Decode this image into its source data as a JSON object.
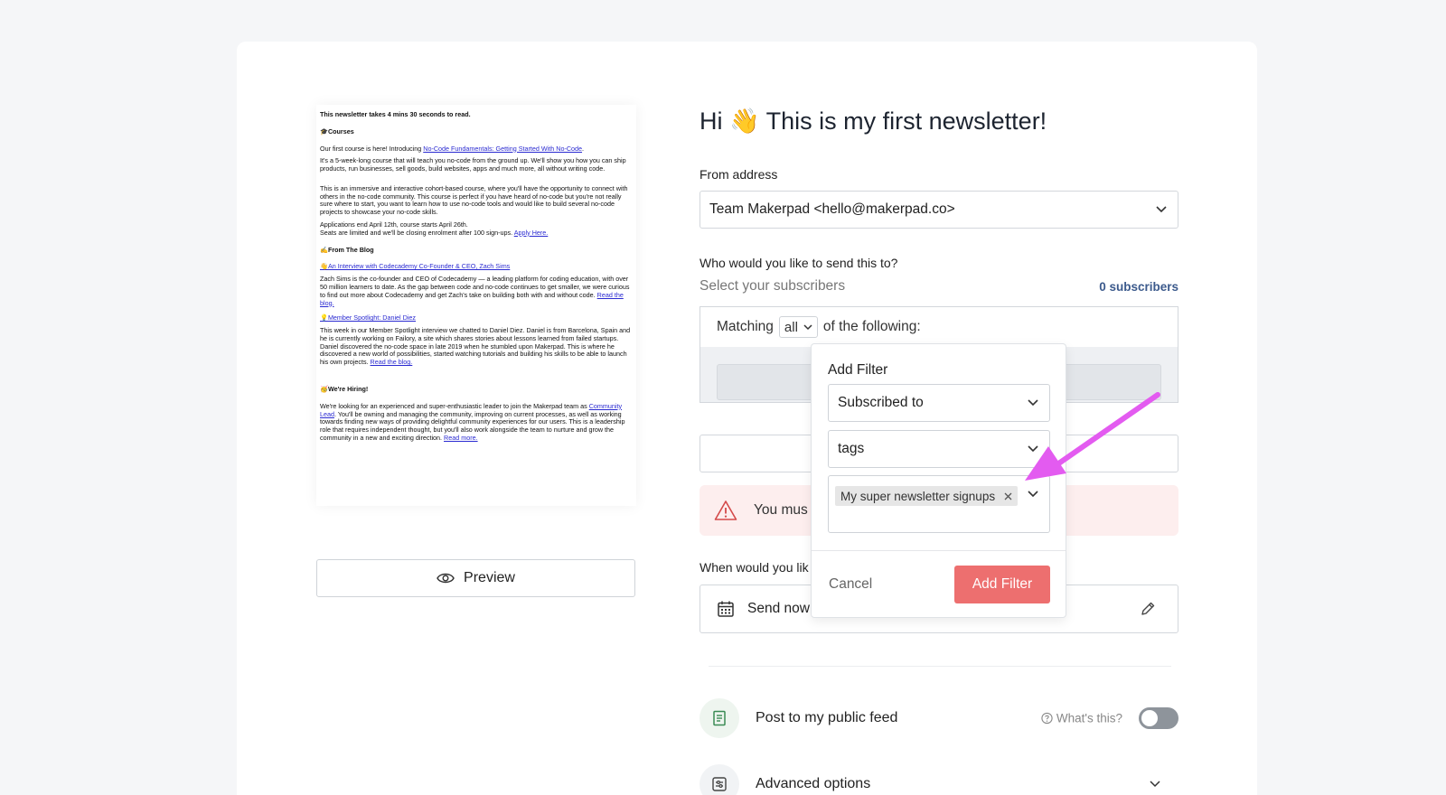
{
  "newsletter": {
    "read_time": "This newsletter takes 4 mins 30 seconds to read.",
    "courses_heading": "🎓Courses",
    "courses_p1_pre": "Our first course is here! Introducing ",
    "courses_p1_link": "No-Code Fundamentals: Getting Started With No-Code",
    "courses_p1_post": ".",
    "courses_p2": "It's a 5-week-long course that will teach you no-code from the ground up. We'll show you how you can ship products, run businesses, sell goods, build websites, apps and much more, all without writing code.",
    "courses_p3": "This is an immersive and interactive cohort-based course, where you'll have the opportunity to connect with others in the no-code community. This course is perfect if you have heard of no-code but you're not really sure where to start, you want to learn how to use no-code tools and would like to build several no-code projects to showcase your no-code skills.",
    "courses_p4a": "Applications end April 12th, course starts April 26th.",
    "courses_p4b_pre": "Seats are limited and we'll be closing enrolment after 100 sign-ups. ",
    "courses_p4b_link": "Apply Here.",
    "blog_heading": "✍️From The Blog",
    "blog_link1": "👋An Interview with Codecademy Co-Founder & CEO, Zach Sims",
    "blog_p1_pre": "Zach Sims is the co-founder and CEO of Codecademy — a leading platform for coding education, with over 50 million learners to date. As the gap between code and no-code continues to get smaller, we were curious to find out more about Codecademy and get Zach's take on building both with and without code. ",
    "blog_p1_link": "Read the blog.",
    "blog_link2": "💡Member Spotlight: Daniel Diez",
    "blog_p2_pre": "This week in our Member Spotlight interview we chatted to Daniel Diez. Daniel is from Barcelona, Spain and he is currently working on Failory, a site which shares stories about lessons learned from failed startups. Daniel discovered the no-code space in late 2019 when he stumbled upon Makerpad. This is where he discovered a new world of possibilities, started watching tutorials and building his skills to be able to launch his own projects. ",
    "blog_p2_link": "Read the blog.",
    "hiring_heading": "🥳We're Hiring!",
    "hiring_p_pre": "We're looking for an experienced and super-enthusiastic leader to join the Makerpad team as ",
    "hiring_p_link1": "Community Lead",
    "hiring_p_mid": ". You'll be owning and managing the community, improving on current processes, as well as working towards finding new ways of providing delightful community experiences for our users. This is a leadership role that requires independent thought, but you'll also work alongside the team to nurture and grow the community in a new and exciting direction. ",
    "hiring_p_link2": "Read more."
  },
  "preview_label": "Preview",
  "title": "Hi 👋 This is my first newsletter!",
  "from": {
    "label": "From address",
    "value": "Team Makerpad <hello@makerpad.co>"
  },
  "recipients": {
    "label": "Who would you like to send this to?",
    "placeholder": "Select your subscribers",
    "count": "0 subscribers",
    "matching_pre": "Matching",
    "matching_value": "all",
    "matching_post": "of the following:"
  },
  "alert_text": "You mus",
  "schedule": {
    "label": "When would you lik",
    "value": "Send now"
  },
  "options": {
    "public_feed": "Post to my public feed",
    "whats_this": "What's this?",
    "advanced": "Advanced options"
  },
  "popover": {
    "title": "Add Filter",
    "field1": "Subscribed to",
    "field2": "tags",
    "chip": "My super newsletter signups",
    "cancel": "Cancel",
    "submit": "Add Filter"
  },
  "colors": {
    "accent_button": "#ed6f6f",
    "annotation_arrow": "#e35bf0",
    "subscriber_count": "#3c5a8c",
    "alert_bg": "#fdeeee"
  }
}
